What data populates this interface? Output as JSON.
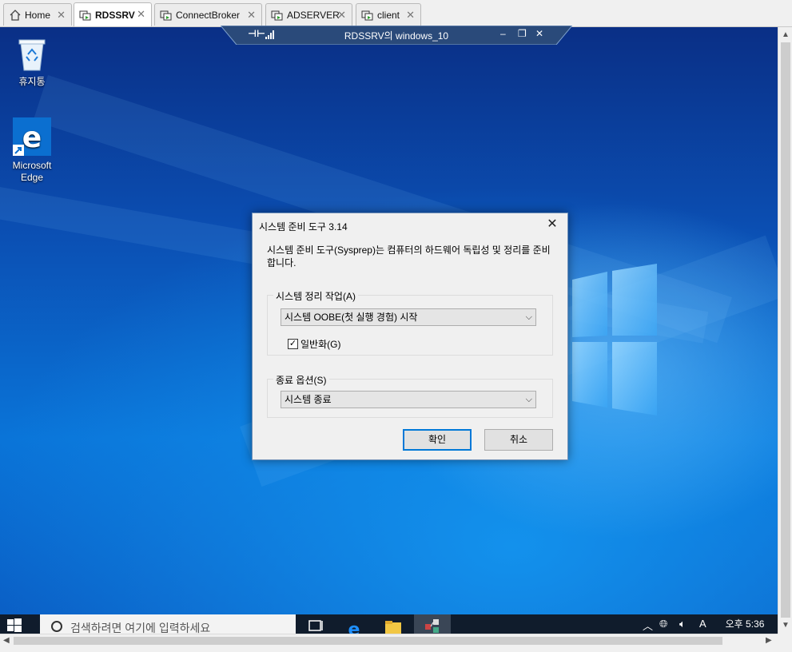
{
  "tabs": [
    {
      "label": "Home",
      "icon": "home-icon"
    },
    {
      "label": "RDSSRV",
      "icon": "vm-icon",
      "active": true
    },
    {
      "label": "ConnectBroker",
      "icon": "vm-icon"
    },
    {
      "label": "ADSERVER",
      "icon": "vm-icon"
    },
    {
      "label": "client",
      "icon": "vm-icon"
    }
  ],
  "tab_close_glyph": "✕",
  "connection_bar": {
    "title": "RDSSRV의 windows_10",
    "minimize": "–",
    "restore": "❐",
    "close": "✕"
  },
  "desktop": {
    "icons": [
      {
        "label": "휴지통",
        "icon": "recycle-bin-icon"
      },
      {
        "label": "Microsoft Edge",
        "icon": "edge-icon"
      }
    ]
  },
  "dialog": {
    "title": "시스템 준비 도구 3.14",
    "description": "시스템 준비 도구(Sysprep)는 컴퓨터의 하드웨어 독립성 및 정리를 준비합니다.",
    "cleanup_group_label": "시스템 정리 작업(A)",
    "cleanup_action_value": "시스템 OOBE(첫 실행 경험) 시작",
    "generalize_label": "일반화(G)",
    "generalize_checked": true,
    "shutdown_group_label": "종료 옵션(S)",
    "shutdown_value": "시스템 종료",
    "ok_label": "확인",
    "cancel_label": "취소"
  },
  "taskbar": {
    "search_placeholder": "검색하려면 여기에 입력하세요",
    "clock_label": "오후 5:36",
    "ime_label": "A"
  },
  "colors": {
    "accent": "#0078d7",
    "taskbar": "#101c2c",
    "desktop_deep": "#0a2f86",
    "desktop_light": "#0a74d8"
  }
}
